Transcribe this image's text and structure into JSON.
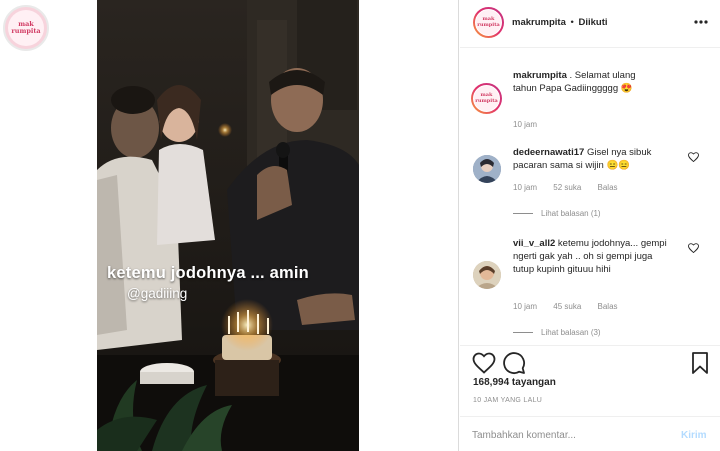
{
  "brand": {
    "logo_text": "mak rumpita",
    "ring_colors": [
      "#f9a13a",
      "#e1306c",
      "#c13584"
    ]
  },
  "video": {
    "caption": "ketemu jodohnya ... amin",
    "mention": "@gadiiing"
  },
  "post_header": {
    "username": "makrumpita",
    "separator": "•",
    "follow_status": "Diikuti",
    "more_icon": "more-horizontal-icon"
  },
  "comments": [
    {
      "username": "makrumpita",
      "text": ". Selamat ulang tahun Papa Gadiinggggg",
      "emoji": "😍",
      "time": "10 jam"
    },
    {
      "username": "dedeernawati17",
      "text": "Gisel nya sibuk pacaran sama si wijin",
      "emoji": "😑😑",
      "time": "10 jam",
      "likes": "52 suka",
      "reply_label": "Balas",
      "view_replies": "Lihat balasan (1)"
    },
    {
      "username": "vii_v_all2",
      "text": "ketemu jodohnya... gempi ngerti gak yah .. oh si gempi juga tutup kupinh gituuu hihi",
      "time": "10 jam",
      "likes": "45 suka",
      "reply_label": "Balas",
      "view_replies": "Lihat balasan (3)"
    }
  ],
  "stats": {
    "views": "168,994 tayangan",
    "posted": "10 JAM YANG LALU"
  },
  "add_comment": {
    "placeholder": "Tambahkan komentar...",
    "post_label": "Kirim",
    "post_color": "#b3dbff"
  }
}
